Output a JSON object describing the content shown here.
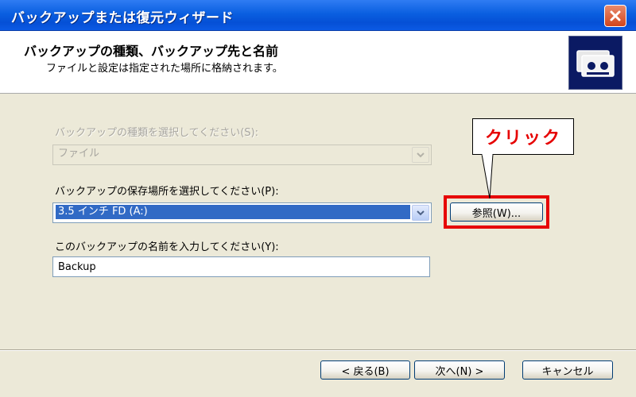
{
  "window": {
    "title": "バックアップまたは復元ウィザード"
  },
  "header": {
    "title": "バックアップの種類、バックアップ先と名前",
    "subtitle": "ファイルと設定は指定された場所に格納されます。",
    "icon": "backup-tapes-icon"
  },
  "form": {
    "backup_type": {
      "label": "バックアップの種類を選択してください(S):",
      "value": "ファイル",
      "enabled": false
    },
    "backup_location": {
      "label": "バックアップの保存場所を選択してください(P):",
      "value": "3.5 インチ FD (A:)",
      "browse_label": "参照(W)..."
    },
    "backup_name": {
      "label": "このバックアップの名前を入力してください(Y):",
      "value": "Backup"
    }
  },
  "annotation": {
    "callout_text": "クリック",
    "highlight_color": "#e60000"
  },
  "footer": {
    "back_label": "< 戻る(B)",
    "next_label": "次へ(N) >",
    "cancel_label": "キャンセル"
  },
  "colors": {
    "titlebar": "#0a5fe0",
    "selection": "#316ac5",
    "dialog_bg": "#ece9d8"
  }
}
